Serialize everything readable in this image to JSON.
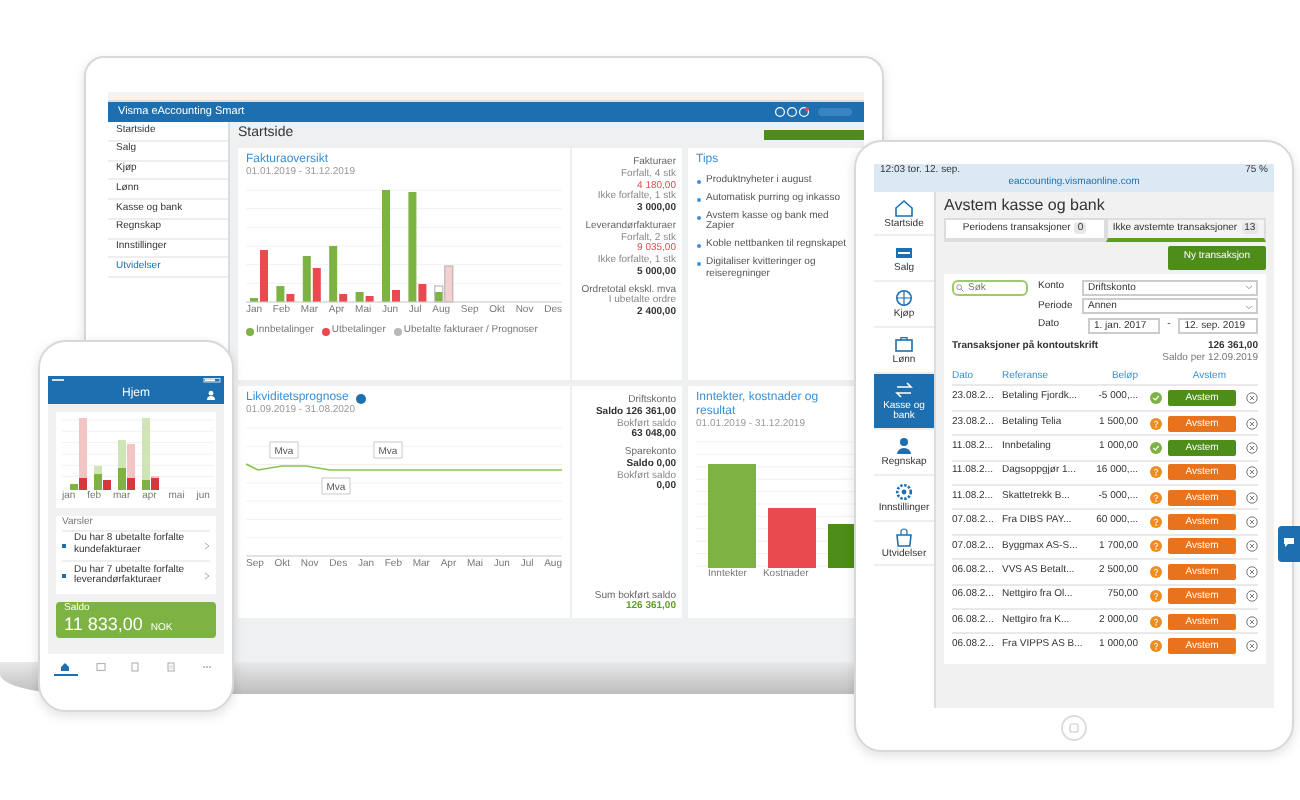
{
  "laptop": {
    "app_title": "Visma eAccounting Smart",
    "sidebar": [
      "Startside",
      "Salg",
      "Kjøp",
      "Lønn",
      "Kasse og bank",
      "Regnskap",
      "Innstillinger",
      "Utvidelser"
    ],
    "page_title": "Startside",
    "invoice_card": {
      "title": "Fakturaoversikt",
      "subtitle": "01.01.2019 - 31.12.2019",
      "months": [
        "Jan",
        "Feb",
        "Mar",
        "Apr",
        "Mai",
        "Jun",
        "Jul",
        "Aug",
        "Sep",
        "Okt",
        "Nov",
        "Des"
      ],
      "legend": [
        {
          "label": "Innbetalinger",
          "color": "#7cb342"
        },
        {
          "label": "Utbetalinger",
          "color": "#e84a4f"
        },
        {
          "label": "Ubetalte fakturaer / Prognoser",
          "color": "#b9b9b9"
        }
      ],
      "stats": [
        {
          "kind": "heading",
          "text": "Fakturaer"
        },
        {
          "kind": "label",
          "text": "Forfalt, 4 stk"
        },
        {
          "kind": "overdue",
          "text": "4 180,00"
        },
        {
          "kind": "label",
          "text": "Ikke forfalte, 1 stk"
        },
        {
          "kind": "value",
          "text": "3 000,00"
        },
        {
          "kind": "heading",
          "text": "Leverandørfakturaer"
        },
        {
          "kind": "label",
          "text": "Forfalt, 2 stk"
        },
        {
          "kind": "overdue",
          "text": "9 035,00"
        },
        {
          "kind": "label",
          "text": "Ikke forfalte, 1 stk"
        },
        {
          "kind": "value",
          "text": "5 000,00"
        },
        {
          "kind": "heading",
          "text": "Ordretotal ekskl. mva"
        },
        {
          "kind": "label",
          "text": "I ubetalte ordre"
        },
        {
          "kind": "value",
          "text": "2 400,00"
        }
      ]
    },
    "tips": {
      "title": "Tips",
      "items": [
        "Produktnyheter i august",
        "Automatisk purring og inkasso",
        "Avstem kasse og bank med Zapier",
        "Koble nettbanken til regnskapet",
        "Digitaliser kvitteringer og reiseregninger"
      ]
    },
    "liquidity_card": {
      "title": "Likviditetsprognose",
      "subtitle": "01.09.2019 - 31.08.2020",
      "months": [
        "Sep",
        "Okt",
        "Nov",
        "Des",
        "Jan",
        "Feb",
        "Mar",
        "Apr",
        "Mai",
        "Jun",
        "Jul",
        "Aug"
      ],
      "markers": [
        "Mva",
        "Mva",
        "Mva"
      ],
      "stats": [
        {
          "kind": "heading",
          "text": "Driftskonto"
        },
        {
          "kind": "value",
          "text": "Saldo 126 361,00"
        },
        {
          "kind": "label",
          "text": "Bokført saldo"
        },
        {
          "kind": "value",
          "text": "63 048,00"
        },
        {
          "kind": "heading",
          "text": "Sparekonto"
        },
        {
          "kind": "value",
          "text": "Saldo 0,00"
        },
        {
          "kind": "label",
          "text": "Bokført saldo"
        },
        {
          "kind": "value",
          "text": "0,00"
        },
        {
          "kind": "spacer",
          "text": "Sum bokført saldo"
        },
        {
          "kind": "total",
          "text": "126 361,00"
        }
      ]
    },
    "result_card": {
      "title": "Inntekter, kostnader og resultat",
      "subtitle": "01.01.2019 - 31.12.2019",
      "categories": [
        "Inntekter",
        "Kostnader"
      ]
    }
  },
  "phone": {
    "title": "Hjem",
    "months": [
      "jan",
      "feb",
      "mar",
      "apr",
      "mai",
      "jun"
    ],
    "alerts_title": "Varsler",
    "alerts": [
      "Du har 8 ubetalte forfalte kundefakturaer",
      "Du har 7 ubetalte forfalte leverandørfakturaer"
    ],
    "balance": {
      "label": "Saldo",
      "amount": "11 833,00",
      "currency": "NOK"
    },
    "nav": [
      {
        "selected": true
      },
      {
        "selected": false
      },
      {
        "selected": false
      },
      {
        "selected": false
      },
      {
        "selected": false
      }
    ]
  },
  "tablet": {
    "status_time": "12:03  tor. 12. sep.",
    "url": "eaccounting.vismaonline.com",
    "battery": "75 %",
    "sidebar": [
      {
        "label": "Startside",
        "selected": false
      },
      {
        "label": "Salg",
        "selected": false
      },
      {
        "label": "Kjøp",
        "selected": false
      },
      {
        "label": "Lønn",
        "selected": false
      },
      {
        "label": "Kasse og bank",
        "selected": true
      },
      {
        "label": "Regnskap",
        "selected": false
      },
      {
        "label": "Innstillinger",
        "selected": false
      },
      {
        "label": "Utvidelser",
        "selected": false
      }
    ],
    "title": "Avstem kasse og bank",
    "tabs": [
      {
        "label": "Periodens transaksjoner",
        "count": "0",
        "selected": false
      },
      {
        "label": "Ikke avstemte transaksjoner",
        "count": "13",
        "selected": true
      }
    ],
    "new_button": "Ny transaksjon",
    "search": {
      "placeholder": "Søk"
    },
    "filters": [
      {
        "label": "Konto",
        "value": "Driftskonto"
      },
      {
        "label": "Periode",
        "value": "Annen"
      }
    ],
    "date": {
      "label": "Dato",
      "from": "1. jan. 2017",
      "separator": "-",
      "to": "12. sep. 2019"
    },
    "statement": {
      "title": "Transaksjoner på kontoutskrift",
      "amount": "126 361,00",
      "caption": "Saldo per 12.09.2019"
    },
    "columns": [
      "Dato",
      "Referanse",
      "Beløp",
      "Avstem"
    ],
    "rows": [
      {
        "date": "23.08.2...",
        "reference": "Betaling Fjordk...",
        "amount": "-5 000,...",
        "kind": "matched",
        "action": "Avstem"
      },
      {
        "date": "23.08.2...",
        "reference": "Betaling Telia",
        "amount": "1 500,00",
        "kind": "suggested",
        "action": "Avstem"
      },
      {
        "date": "11.08.2...",
        "reference": "Innbetaling",
        "amount": "1 000,00",
        "kind": "matched",
        "action": "Avstem"
      },
      {
        "date": "11.08.2...",
        "reference": "Dagsoppgjør 1...",
        "amount": "16 000,...",
        "kind": "suggested",
        "action": "Avstem"
      },
      {
        "date": "11.08.2...",
        "reference": "Skattetrekk B...",
        "amount": "-5 000,...",
        "kind": "suggested",
        "action": "Avstem"
      },
      {
        "date": "07.08.2...",
        "reference": "Fra DIBS PAY...",
        "amount": "60 000,...",
        "kind": "suggested",
        "action": "Avstem"
      },
      {
        "date": "07.08.2...",
        "reference": "Byggmax AS-S...",
        "amount": "1 700,00",
        "kind": "suggested",
        "action": "Avstem"
      },
      {
        "date": "06.08.2...",
        "reference": "VVS AS Betalt...",
        "amount": "2 500,00",
        "kind": "suggested",
        "action": "Avstem"
      },
      {
        "date": "06.08.2...",
        "reference": "Nettgiro fra Ol...",
        "amount": "750,00",
        "kind": "suggested",
        "action": "Avstem"
      },
      {
        "date": "06.08.2...",
        "reference": "Nettgiro fra K...",
        "amount": "2 000,00",
        "kind": "suggested",
        "action": "Avstem"
      },
      {
        "date": "06.08.2...",
        "reference": "Fra VIPPS AS B...",
        "amount": "1 000,00",
        "kind": "suggested",
        "action": "Avstem"
      }
    ]
  }
}
